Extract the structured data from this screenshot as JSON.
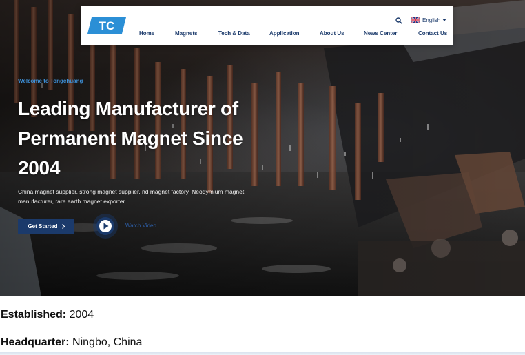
{
  "nav": {
    "logo_text": "TC",
    "links": [
      "Home",
      "Magnets",
      "Tech & Data",
      "Application",
      "About Us",
      "News Center",
      "Contact Us"
    ],
    "language": "English",
    "brand_color": "#1b3a6b",
    "logo_color": "#2b8fd6"
  },
  "icons": {
    "search": "search-icon",
    "flag": "uk-flag-icon",
    "language_chevron": "chevron-down-icon",
    "cta_chevron": "chevron-right-icon",
    "play": "play-icon"
  },
  "hero": {
    "welcome": "Welcome to Tongchuang",
    "headline": "Leading Manufacturer of Permanent Magnet Since 2004",
    "subtext": "China magnet supplier, strong magnet supplier, nd magnet factory, Neodymium magnet manufacturer, rare earth magnet exporter.",
    "cta_label": "Get Started",
    "video_link": "Watch Video"
  },
  "info": {
    "established_label": "Established:",
    "established_value": "2004",
    "hq_label": "Headquarter:",
    "hq_value": "Ningbo, China"
  }
}
